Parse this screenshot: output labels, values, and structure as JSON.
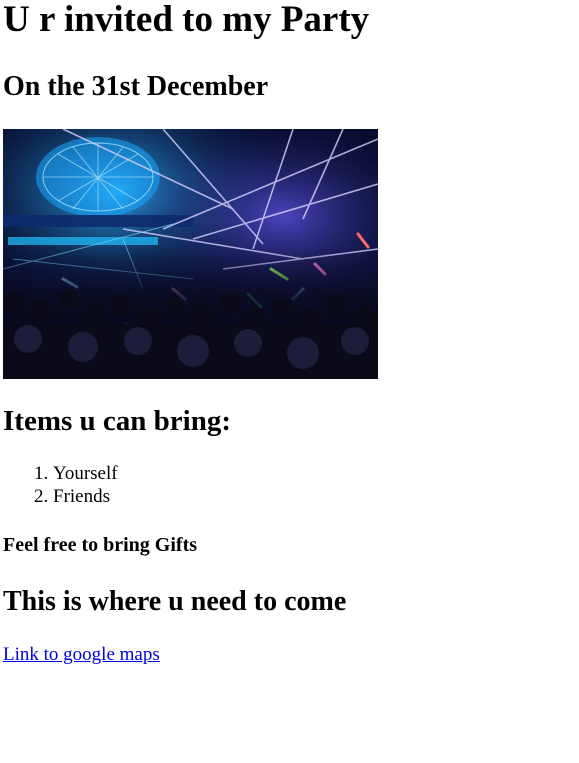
{
  "header": {
    "title": "U r invited to my Party",
    "date_line": "On the 31st December"
  },
  "photo": {
    "icon": "party-crowd-photo",
    "colors": {
      "background": "#070b2a",
      "light_blue": "#3ec8ff",
      "laser_violet": "#b6a8ff",
      "crowd": "#0a0a18"
    }
  },
  "items": {
    "heading": "Items u can bring:",
    "list": [
      "Yourself",
      "Friends"
    ]
  },
  "gifts_note": "Feel free to bring Gifts",
  "location": {
    "heading": "This is where u need to come",
    "link_text": "Link to google maps",
    "link_color": "#0000ee"
  }
}
